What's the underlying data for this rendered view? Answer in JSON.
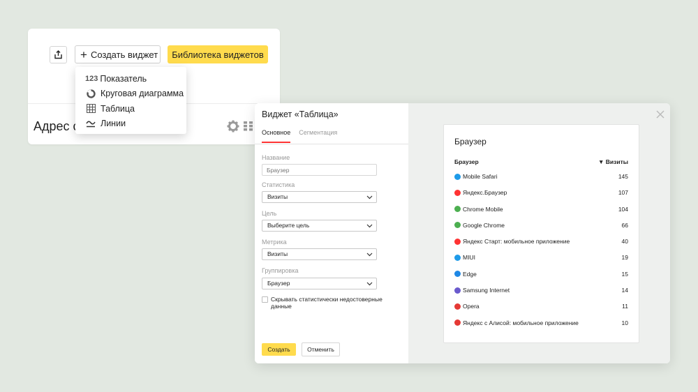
{
  "toolbar": {
    "create_widget_label": "Создать виджет",
    "library_label": "Библиотека виджетов"
  },
  "dropdown": {
    "items": [
      {
        "label": "Показатель",
        "icon": "number-123-icon",
        "prefix": "123"
      },
      {
        "label": "Круговая диаграмма",
        "icon": "pie-chart-icon"
      },
      {
        "label": "Таблица",
        "icon": "table-grid-icon"
      },
      {
        "label": "Линии",
        "icon": "line-chart-icon"
      }
    ]
  },
  "dashboard": {
    "address_title": "Адрес ст"
  },
  "modal": {
    "title": "Виджет «Таблица»",
    "tabs": [
      "Основное",
      "Сегментация"
    ],
    "active_tab": "Основное",
    "fields": {
      "name_label": "Название",
      "name_placeholder": "Браузер",
      "statistics_label": "Статистика",
      "statistics_value": "Визиты",
      "goal_label": "Цель",
      "goal_value": "Выберите цель",
      "metric_label": "Метрика",
      "metric_value": "Визиты",
      "grouping_label": "Группировка",
      "grouping_value": "Браузер"
    },
    "checkbox_label": "Скрывать статистически недостоверные данные",
    "create_label": "Создать",
    "cancel_label": "Отменить"
  },
  "preview": {
    "title": "Браузер",
    "col_browser": "Браузер",
    "col_visits": "▼ Визиты",
    "rows": [
      {
        "name": "Mobile Safari",
        "value": "145",
        "color": "#1e9be9"
      },
      {
        "name": "Яндекс.Браузер",
        "value": "107",
        "color": "#f33"
      },
      {
        "name": "Chrome Mobile",
        "value": "104",
        "color": "#4caf50"
      },
      {
        "name": "Google Chrome",
        "value": "66",
        "color": "#4caf50"
      },
      {
        "name": "Яндекс Старт: мобильное приложение",
        "value": "40",
        "color": "#f33"
      },
      {
        "name": "MIUI",
        "value": "19",
        "color": "#1e9be9"
      },
      {
        "name": "Edge",
        "value": "15",
        "color": "#1e88e5"
      },
      {
        "name": "Samsung Internet",
        "value": "14",
        "color": "#6a5acd"
      },
      {
        "name": "Opera",
        "value": "11",
        "color": "#e53935"
      },
      {
        "name": "Яндекс с Алисой: мобильное приложение",
        "value": "10",
        "color": "#e53935"
      }
    ]
  },
  "colors": {
    "background": "#e2e8e1",
    "accent_yellow": "#ffdb4d",
    "tab_underline": "#ff3333"
  }
}
